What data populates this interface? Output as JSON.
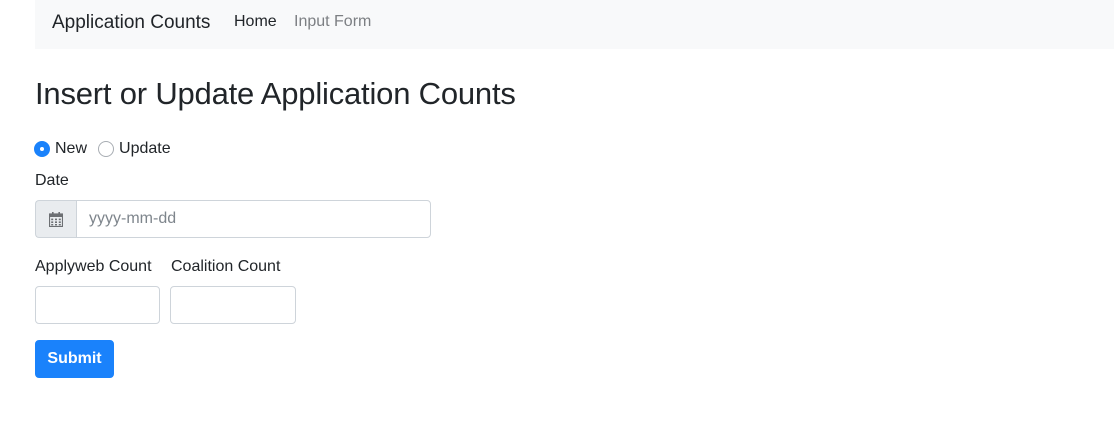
{
  "navbar": {
    "brand": "Application Counts",
    "links": [
      {
        "label": "Home",
        "active": true
      },
      {
        "label": "Input Form",
        "active": false
      }
    ]
  },
  "page": {
    "title": "Insert or Update Application Counts"
  },
  "form": {
    "mode_options": [
      {
        "label": "New",
        "checked": true
      },
      {
        "label": "Update",
        "checked": false
      }
    ],
    "date": {
      "label": "Date",
      "placeholder": "yyyy-mm-dd",
      "value": "",
      "icon": "calendar-icon"
    },
    "applyweb": {
      "label": "Applyweb Count",
      "value": ""
    },
    "coalition": {
      "label": "Coalition Count",
      "value": ""
    },
    "submit_label": "Submit"
  },
  "colors": {
    "accent": "#1a82fb",
    "navbar_bg": "#f8f9fa",
    "addon_bg": "#e9ecef"
  }
}
